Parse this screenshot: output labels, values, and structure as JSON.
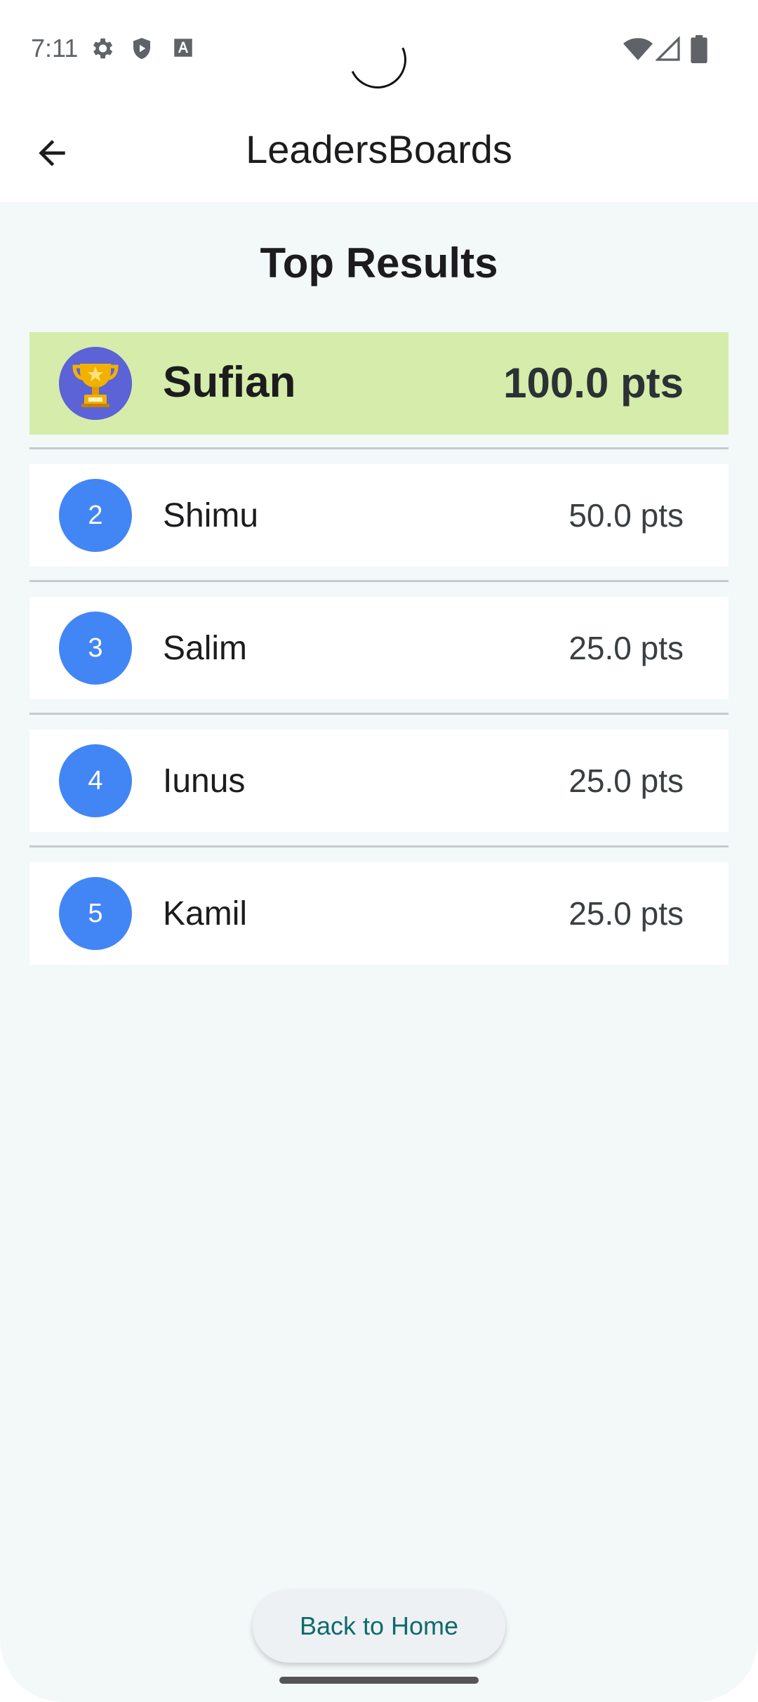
{
  "status_bar": {
    "time": "7:11",
    "icons": [
      "gear-icon",
      "shield-play-icon",
      "font-a-icon",
      "wifi-icon",
      "signal-icon",
      "battery-icon"
    ]
  },
  "app_bar": {
    "title": "LeadersBoards",
    "back_icon": "arrow-left-icon"
  },
  "page": {
    "section_title": "Top Results"
  },
  "leaderboard": [
    {
      "rank": "1",
      "name": "Sufian",
      "points": "100.0 pts",
      "avatar": "trophy-icon"
    },
    {
      "rank": "2",
      "name": "Shimu",
      "points": "50.0 pts"
    },
    {
      "rank": "3",
      "name": "Salim",
      "points": "25.0 pts"
    },
    {
      "rank": "4",
      "name": "Iunus",
      "points": "25.0 pts"
    },
    {
      "rank": "5",
      "name": "Kamil",
      "points": "25.0 pts"
    }
  ],
  "actions": {
    "back_home_label": "Back to Home"
  },
  "colors": {
    "top_row": "#d5ecab",
    "rank_circle": "#4286f5",
    "background": "#f3f8f9",
    "button_text": "#0f6a6e"
  }
}
